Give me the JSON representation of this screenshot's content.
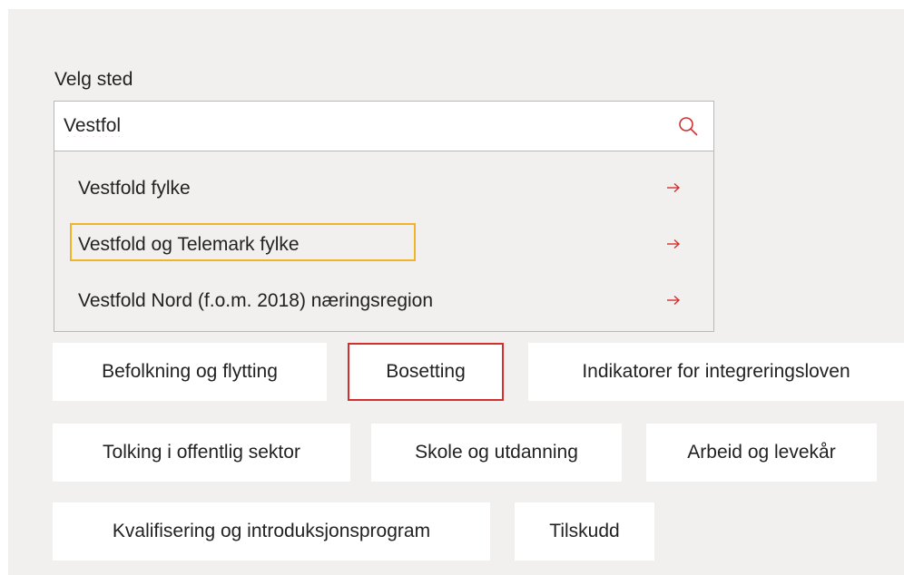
{
  "search": {
    "label": "Velg sted",
    "value": "Vestfol",
    "icon": "search-icon",
    "accent_color": "#d42f2f"
  },
  "suggestions": [
    {
      "label": "Vestfold fylke"
    },
    {
      "label": "Vestfold og Telemark fylke",
      "focused": true
    },
    {
      "label": "Vestfold Nord (f.o.m. 2018) næringsregion"
    }
  ],
  "topics": [
    {
      "label": "Befolkning og flytting"
    },
    {
      "label": "Bosetting",
      "selected": true
    },
    {
      "label": "Indikatorer for integreringsloven"
    },
    {
      "label": "Tolking i offentlig sektor"
    },
    {
      "label": "Skole og utdanning"
    },
    {
      "label": "Arbeid og levekår"
    },
    {
      "label": "Kvalifisering og introduksjonsprogram"
    },
    {
      "label": "Tilskudd"
    }
  ]
}
